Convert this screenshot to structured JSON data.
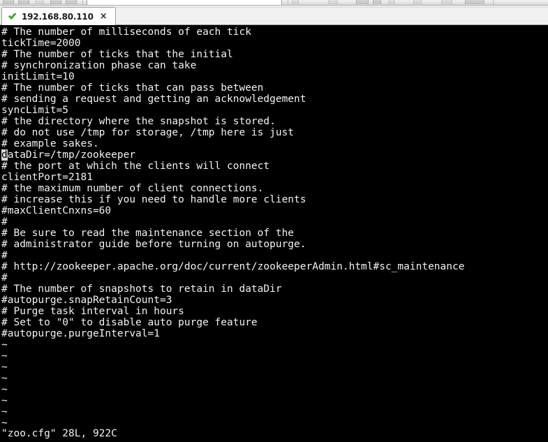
{
  "toolbar": {
    "name": "cropped-toolbar",
    "icons": [
      "toolbar-icon-1",
      "toolbar-icon-2",
      "toolbar-icon-3",
      "toolbar-icon-4",
      "toolbar-icon-5",
      "toolbar-icon-6",
      "toolbar-icon-7",
      "toolbar-icon-8",
      "toolbar-icon-9",
      "toolbar-icon-10",
      "toolbar-icon-11",
      "toolbar-icon-12",
      "toolbar-icon-13"
    ],
    "field_value": ""
  },
  "tabs": [
    {
      "label": "192.168.80.110",
      "status_icon": "green-check-icon",
      "status_color": "#3fa629",
      "close_label": "×",
      "active": true
    }
  ],
  "terminal": {
    "background_color": "#000000",
    "foreground_color": "#f2f2f2",
    "cursor_color": "#d8d8d8",
    "cursor_line_index": 9,
    "cursor_char": "d",
    "lines": [
      "# The number of milliseconds of each tick",
      "tickTime=2000",
      "# The number of ticks that the initial",
      "# synchronization phase can take",
      "initLimit=10",
      "# The number of ticks that can pass between",
      "# sending a request and getting an acknowledgement",
      "syncLimit=5",
      "# the directory where the snapshot is stored.",
      "# do not use /tmp for storage, /tmp here is just",
      "# example sakes.",
      "dataDir=/tmp/zookeeper",
      "# the port at which the clients will connect",
      "clientPort=2181",
      "# the maximum number of client connections.",
      "# increase this if you need to handle more clients",
      "#maxClientCnxns=60",
      "#",
      "# Be sure to read the maintenance section of the",
      "# administrator guide before turning on autopurge.",
      "#",
      "# http://zookeeper.apache.org/doc/current/zookeeperAdmin.html#sc_maintenance",
      "#",
      "# The number of snapshots to retain in dataDir",
      "#autopurge.snapRetainCount=3",
      "# Purge task interval in hours",
      "# Set to \"0\" to disable auto purge feature",
      "#autopurge.purgeInterval=1"
    ],
    "cursor_line_text_before": "",
    "cursor_line_text_after": "ataDir=/tmp/zookeeper",
    "tilde_lines": [
      "~",
      "~",
      "~",
      "~",
      "~",
      "~",
      "~",
      "~"
    ],
    "status_line": "\"zoo.cfg\" 28L, 922C"
  }
}
